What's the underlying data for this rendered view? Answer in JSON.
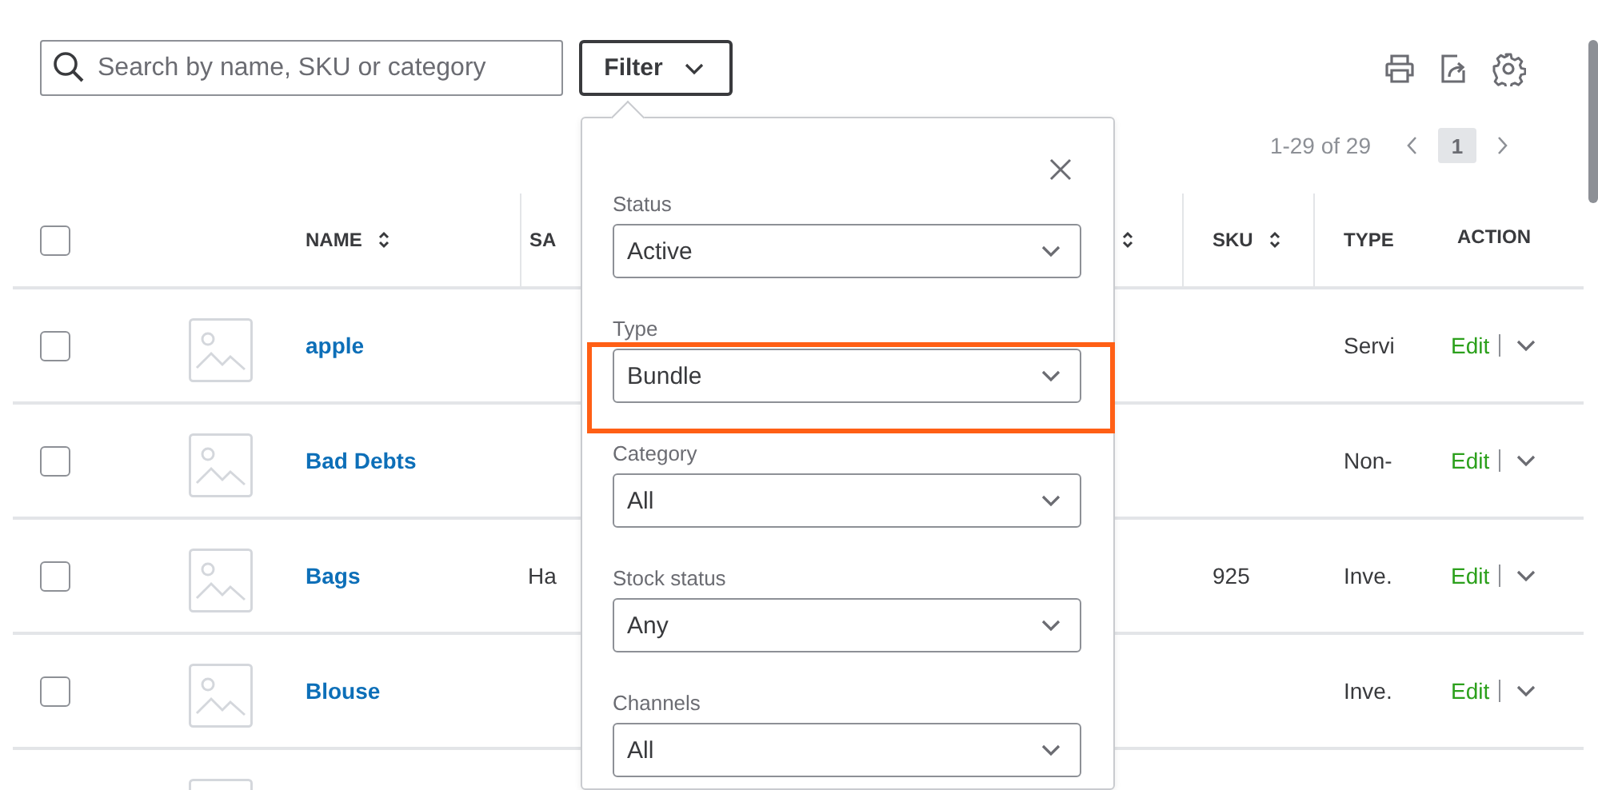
{
  "search": {
    "placeholder": "Search by name, SKU or category"
  },
  "filter_button": {
    "label": "Filter"
  },
  "pagination": {
    "range": "1-29 of 29",
    "pages": [
      {
        "label": "1",
        "selected": true
      }
    ]
  },
  "table": {
    "select_all": {
      "checked": false
    },
    "columns": [
      {
        "label": "NAME",
        "sortable": true
      },
      {
        "label": "SA",
        "sortable": false
      },
      {
        "sortable": true
      },
      {
        "label": "SKU",
        "sortable": true
      },
      {
        "label": "TYPE",
        "sortable": false
      },
      {
        "label": "ACTION",
        "sortable": false
      }
    ],
    "rows": [
      {
        "checked": false,
        "name": "apple",
        "type": "Servi",
        "action": "Edit"
      },
      {
        "checked": false,
        "name": "Bad Debts",
        "type": "Non-",
        "action": "Edit"
      },
      {
        "checked": false,
        "name": "Bags",
        "sales": "Ha",
        "sku": "925",
        "type": "Inve.",
        "action": "Edit"
      },
      {
        "checked": false,
        "name": "Blouse",
        "type": "Inve.",
        "action": "Edit"
      },
      {}
    ]
  },
  "filter_panel": {
    "filters": [
      {
        "label": "Status",
        "value": "Active",
        "highlighted": false
      },
      {
        "label": "Type",
        "value": "Bundle",
        "highlighted": true
      },
      {
        "label": "Category",
        "value": "All",
        "highlighted": false
      },
      {
        "label": "Stock status",
        "value": "Any",
        "highlighted": false
      },
      {
        "label": "Channels",
        "value": "All",
        "highlighted": false
      }
    ]
  }
}
